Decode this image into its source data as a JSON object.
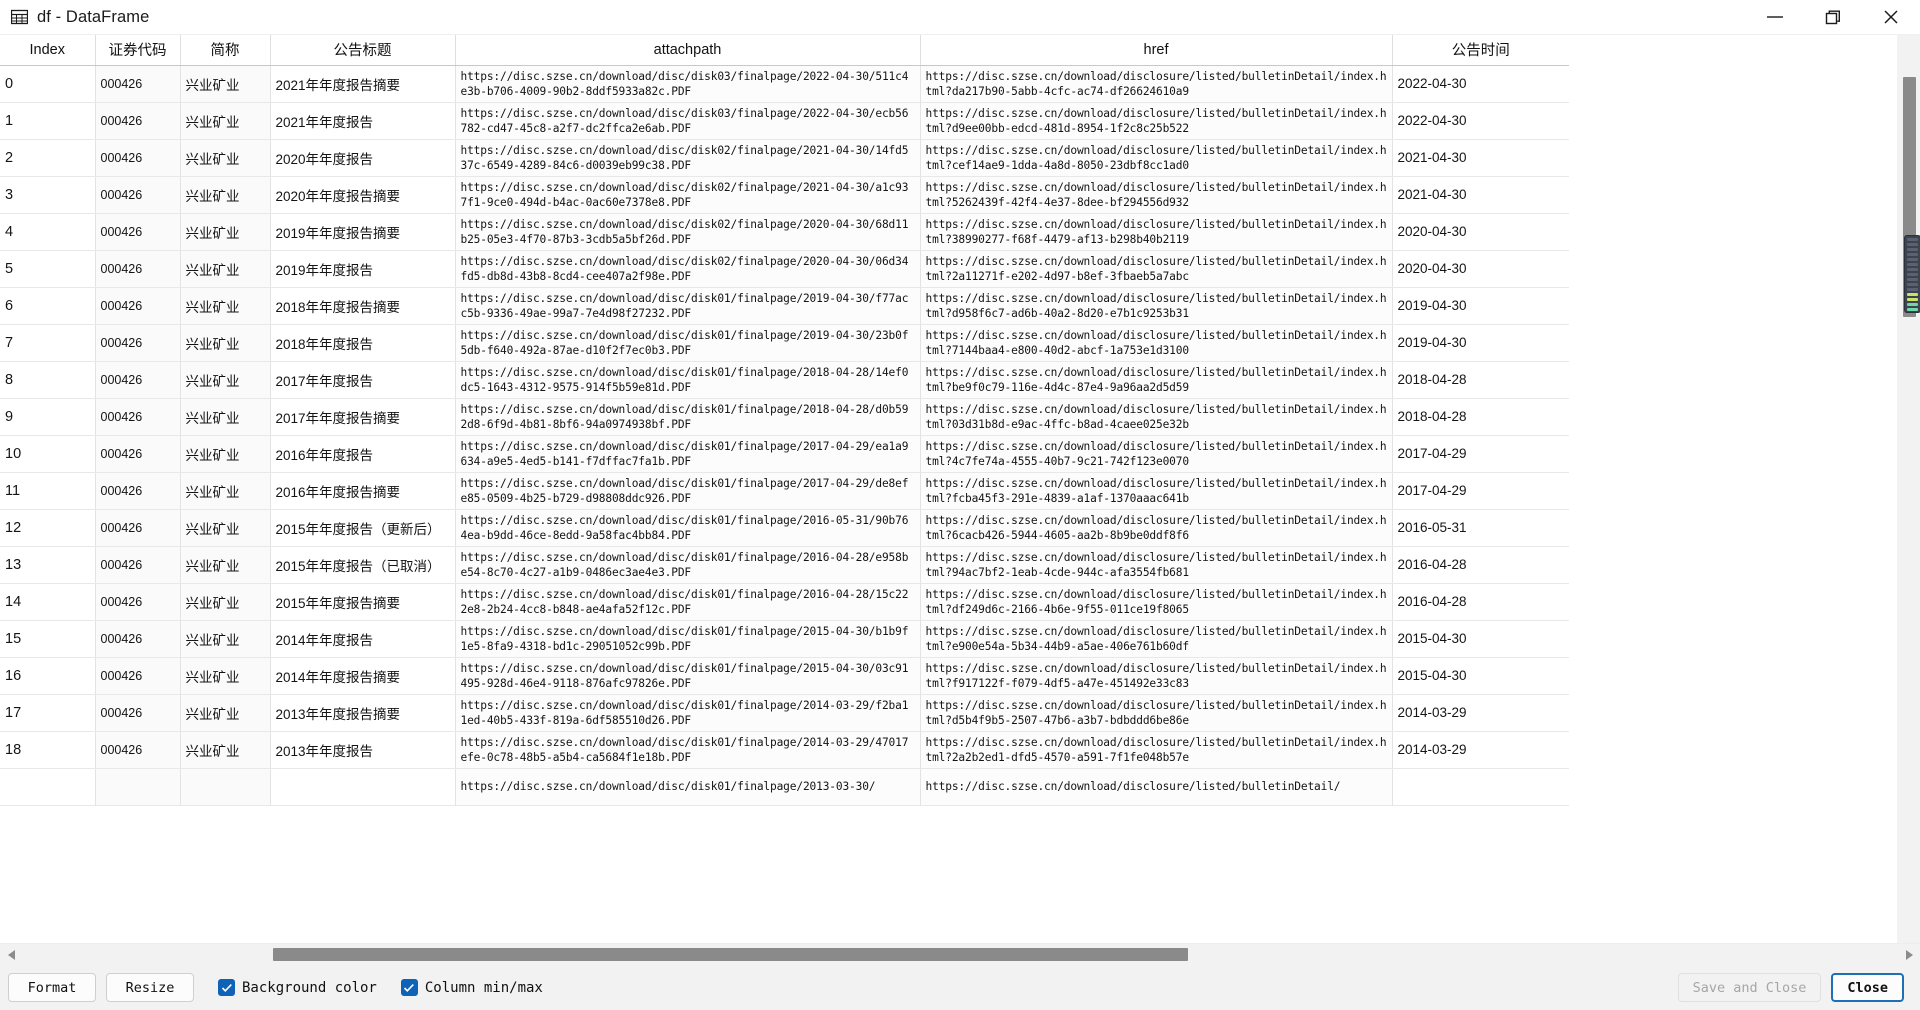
{
  "window": {
    "title": "df - DataFrame",
    "icon": "table-grid-icon",
    "controls": {
      "minimize": "minimize-icon",
      "restore": "restore-icon",
      "close": "close-icon"
    }
  },
  "colors": {
    "accent": "#0d63b8",
    "focus_border": "#1f6fb5",
    "scrollbar_thumb": "#8a8a8a",
    "scrollbar_track": "#f2f2f2",
    "toolbar_bg": "#f2f2f2",
    "grid_line": "#e3e3e3",
    "tinted_cell_bg": "#fafafa"
  },
  "table": {
    "columns": [
      {
        "key": "index",
        "label": "Index"
      },
      {
        "key": "code",
        "label": "证券代码"
      },
      {
        "key": "name",
        "label": "简称"
      },
      {
        "key": "title",
        "label": "公告标题"
      },
      {
        "key": "attachpath",
        "label": "attachpath"
      },
      {
        "key": "href",
        "label": "href"
      },
      {
        "key": "time",
        "label": "公告时间"
      }
    ],
    "rows": [
      {
        "index": "0",
        "code": "000426",
        "name": "兴业矿业",
        "title": "2021年年度报告摘要",
        "attachpath": "https://disc.szse.cn/download/disc/disk03/finalpage/2022-04-30/511c4e3b-b706-4009-90b2-8ddf5933a82c.PDF",
        "href": "https://disc.szse.cn/download/disclosure/listed/bulletinDetail/index.html?da217b90-5abb-4cfc-ac74-df26624610a9",
        "time": "2022-04-30"
      },
      {
        "index": "1",
        "code": "000426",
        "name": "兴业矿业",
        "title": "2021年年度报告",
        "attachpath": "https://disc.szse.cn/download/disc/disk03/finalpage/2022-04-30/ecb56782-cd47-45c8-a2f7-dc2ffca2e6ab.PDF",
        "href": "https://disc.szse.cn/download/disclosure/listed/bulletinDetail/index.html?d9ee00bb-edcd-481d-8954-1f2c8c25b522",
        "time": "2022-04-30"
      },
      {
        "index": "2",
        "code": "000426",
        "name": "兴业矿业",
        "title": "2020年年度报告",
        "attachpath": "https://disc.szse.cn/download/disc/disk02/finalpage/2021-04-30/14fd537c-6549-4289-84c6-d0039eb99c38.PDF",
        "href": "https://disc.szse.cn/download/disclosure/listed/bulletinDetail/index.html?cef14ae9-1dda-4a8d-8050-23dbf8cc1ad0",
        "time": "2021-04-30"
      },
      {
        "index": "3",
        "code": "000426",
        "name": "兴业矿业",
        "title": "2020年年度报告摘要",
        "attachpath": "https://disc.szse.cn/download/disc/disk02/finalpage/2021-04-30/a1c937f1-9ce0-494d-b4ac-0ac60e7378e8.PDF",
        "href": "https://disc.szse.cn/download/disclosure/listed/bulletinDetail/index.html?5262439f-42f4-4e37-8dee-bf294556d932",
        "time": "2021-04-30"
      },
      {
        "index": "4",
        "code": "000426",
        "name": "兴业矿业",
        "title": "2019年年度报告摘要",
        "attachpath": "https://disc.szse.cn/download/disc/disk02/finalpage/2020-04-30/68d11b25-05e3-4f70-87b3-3cdb5a5bf26d.PDF",
        "href": "https://disc.szse.cn/download/disclosure/listed/bulletinDetail/index.html?38990277-f68f-4479-af13-b298b40b2119",
        "time": "2020-04-30"
      },
      {
        "index": "5",
        "code": "000426",
        "name": "兴业矿业",
        "title": "2019年年度报告",
        "attachpath": "https://disc.szse.cn/download/disc/disk02/finalpage/2020-04-30/06d34fd5-db8d-43b8-8cd4-cee407a2f98e.PDF",
        "href": "https://disc.szse.cn/download/disclosure/listed/bulletinDetail/index.html?2a11271f-e202-4d97-b8ef-3fbaeb5a7abc",
        "time": "2020-04-30"
      },
      {
        "index": "6",
        "code": "000426",
        "name": "兴业矿业",
        "title": "2018年年度报告摘要",
        "attachpath": "https://disc.szse.cn/download/disc/disk01/finalpage/2019-04-30/f77acc5b-9336-49ae-99a7-7e4d98f27232.PDF",
        "href": "https://disc.szse.cn/download/disclosure/listed/bulletinDetail/index.html?d958f6c7-ad6b-40a2-8d20-e7b1c9253b31",
        "time": "2019-04-30"
      },
      {
        "index": "7",
        "code": "000426",
        "name": "兴业矿业",
        "title": "2018年年度报告",
        "attachpath": "https://disc.szse.cn/download/disc/disk01/finalpage/2019-04-30/23b0f5db-f640-492a-87ae-d10f2f7ec0b3.PDF",
        "href": "https://disc.szse.cn/download/disclosure/listed/bulletinDetail/index.html?7144baa4-e800-40d2-abcf-1a753e1d3100",
        "time": "2019-04-30"
      },
      {
        "index": "8",
        "code": "000426",
        "name": "兴业矿业",
        "title": "2017年年度报告",
        "attachpath": "https://disc.szse.cn/download/disc/disk01/finalpage/2018-04-28/14ef0dc5-1643-4312-9575-914f5b59e81d.PDF",
        "href": "https://disc.szse.cn/download/disclosure/listed/bulletinDetail/index.html?be9f0c79-116e-4d4c-87e4-9a96aa2d5d59",
        "time": "2018-04-28"
      },
      {
        "index": "9",
        "code": "000426",
        "name": "兴业矿业",
        "title": "2017年年度报告摘要",
        "attachpath": "https://disc.szse.cn/download/disc/disk01/finalpage/2018-04-28/d0b592d8-6f9d-4b81-8bf6-94a0974938bf.PDF",
        "href": "https://disc.szse.cn/download/disclosure/listed/bulletinDetail/index.html?03d31b8d-e9ac-4ffc-b8ad-4caee025e32b",
        "time": "2018-04-28"
      },
      {
        "index": "10",
        "code": "000426",
        "name": "兴业矿业",
        "title": "2016年年度报告",
        "attachpath": "https://disc.szse.cn/download/disc/disk01/finalpage/2017-04-29/ea1a9634-a9e5-4ed5-b141-f7dffac7fa1b.PDF",
        "href": "https://disc.szse.cn/download/disclosure/listed/bulletinDetail/index.html?4c7fe74a-4555-40b7-9c21-742f123e0070",
        "time": "2017-04-29"
      },
      {
        "index": "11",
        "code": "000426",
        "name": "兴业矿业",
        "title": "2016年年度报告摘要",
        "attachpath": "https://disc.szse.cn/download/disc/disk01/finalpage/2017-04-29/de8efe85-0509-4b25-b729-d98808ddc926.PDF",
        "href": "https://disc.szse.cn/download/disclosure/listed/bulletinDetail/index.html?fcba45f3-291e-4839-a1af-1370aaac641b",
        "time": "2017-04-29"
      },
      {
        "index": "12",
        "code": "000426",
        "name": "兴业矿业",
        "title": "2015年年度报告（更新后）",
        "attachpath": "https://disc.szse.cn/download/disc/disk01/finalpage/2016-05-31/90b764ea-b9dd-46ce-8edd-9a58fac4bb84.PDF",
        "href": "https://disc.szse.cn/download/disclosure/listed/bulletinDetail/index.html?6cacb426-5944-4605-aa2b-8b9be0ddf8f6",
        "time": "2016-05-31"
      },
      {
        "index": "13",
        "code": "000426",
        "name": "兴业矿业",
        "title": "2015年年度报告（已取消）",
        "attachpath": "https://disc.szse.cn/download/disc/disk01/finalpage/2016-04-28/e958be54-8c70-4c27-a1b9-0486ec3ae4e3.PDF",
        "href": "https://disc.szse.cn/download/disclosure/listed/bulletinDetail/index.html?94ac7bf2-1eab-4cde-944c-afa3554fb681",
        "time": "2016-04-28"
      },
      {
        "index": "14",
        "code": "000426",
        "name": "兴业矿业",
        "title": "2015年年度报告摘要",
        "attachpath": "https://disc.szse.cn/download/disc/disk01/finalpage/2016-04-28/15c222e8-2b24-4cc8-b848-ae4afa52f12c.PDF",
        "href": "https://disc.szse.cn/download/disclosure/listed/bulletinDetail/index.html?df249d6c-2166-4b6e-9f55-011ce19f8065",
        "time": "2016-04-28"
      },
      {
        "index": "15",
        "code": "000426",
        "name": "兴业矿业",
        "title": "2014年年度报告",
        "attachpath": "https://disc.szse.cn/download/disc/disk01/finalpage/2015-04-30/b1b9f1e5-8fa9-4318-bd1c-29051052c99b.PDF",
        "href": "https://disc.szse.cn/download/disclosure/listed/bulletinDetail/index.html?e900e54a-5b34-44b9-a5ae-406e761b60df",
        "time": "2015-04-30"
      },
      {
        "index": "16",
        "code": "000426",
        "name": "兴业矿业",
        "title": "2014年年度报告摘要",
        "attachpath": "https://disc.szse.cn/download/disc/disk01/finalpage/2015-04-30/03c91495-928d-46e4-9118-876afc97826e.PDF",
        "href": "https://disc.szse.cn/download/disclosure/listed/bulletinDetail/index.html?f917122f-f079-4df5-a47e-451492e33c83",
        "time": "2015-04-30"
      },
      {
        "index": "17",
        "code": "000426",
        "name": "兴业矿业",
        "title": "2013年年度报告摘要",
        "attachpath": "https://disc.szse.cn/download/disc/disk01/finalpage/2014-03-29/f2ba11ed-40b5-433f-819a-6df585510d26.PDF",
        "href": "https://disc.szse.cn/download/disclosure/listed/bulletinDetail/index.html?d5b4f9b5-2507-47b6-a3b7-bdbddd6be86e",
        "time": "2014-03-29"
      },
      {
        "index": "18",
        "code": "000426",
        "name": "兴业矿业",
        "title": "2013年年度报告",
        "attachpath": "https://disc.szse.cn/download/disc/disk01/finalpage/2014-03-29/47017efe-0c78-48b5-a5b4-ca5684f1e18b.PDF",
        "href": "https://disc.szse.cn/download/disclosure/listed/bulletinDetail/index.html?2a2b2ed1-dfd5-4570-a591-7f1fe048b57e",
        "time": "2014-03-29"
      },
      {
        "index": "",
        "code": "",
        "name": "",
        "title": "",
        "attachpath": "https://disc.szse.cn/download/disc/disk01/finalpage/2013-03-30/",
        "href": "https://disc.szse.cn/download/disclosure/listed/bulletinDetail/",
        "time": ""
      }
    ]
  },
  "toolbar": {
    "format_label": "Format",
    "resize_label": "Resize",
    "background_color_label": "Background color",
    "background_color_checked": true,
    "column_minmax_label": "Column min/max",
    "column_minmax_checked": true,
    "save_and_close_label": "Save and Close",
    "save_and_close_enabled": false,
    "close_label": "Close",
    "close_focused": true
  },
  "scrollbars": {
    "vertical_position_pct": 6,
    "horizontal_position_pct": 21
  }
}
